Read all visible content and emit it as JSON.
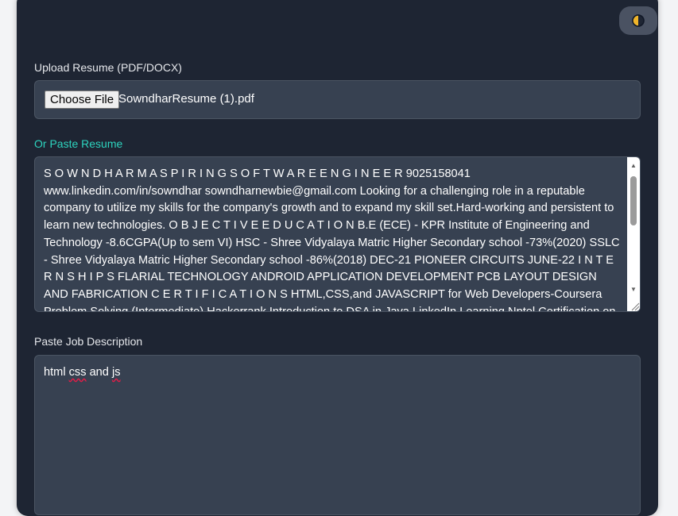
{
  "colors": {
    "page_bg": "#f3f4f6",
    "card_bg": "#1e2533",
    "field_bg": "#374151",
    "accent": "#2dd4bf",
    "toggle_icon": "#f0b52a"
  },
  "header": {
    "theme_toggle_icon": "half-circle-theme-icon"
  },
  "upload": {
    "label": "Upload Resume (PDF/DOCX)",
    "button_label": "Choose File",
    "file_name": "SowndharResume (1).pdf"
  },
  "resume": {
    "label": "Or Paste Resume",
    "text": "S O W N D H A R M A S P I R I N G S O F T W A R E E N G I N E E R 9025158041 www.linkedin.com/in/sowndhar  sowndharnewbie@gmail.com   Looking for a challenging role in a reputable company to utilize my skills for the company's growth and to expand my skill set.Hard-working and persistent to learn new technologies.  O B J E C T I V E  E D U C A T I O N  B.E (ECE) - KPR Institute of Engineering and Technology -8.6CGPA(Up to sem VI) HSC - Shree Vidyalaya Matric Higher Secondary school -73%(2020) SSLC - Shree Vidyalaya Matric Higher Secondary school -86%(2018)  DEC-21  PIONEER CIRCUITS  JUNE-22  I N T E R N S H I P S  FLARIAL TECHNOLOGY  ANDROID APPLICATION DEVELOPMENT  PCB LAYOUT DESIGN AND FABRICATION  C E R T I F I C A T I O N S  HTML,CSS,and JAVASCRIPT for Web Developers-Coursera Problem Solving (Intermediate)  Hackerrank Introduction to DSA in Java  LinkedIn Learning Nptel Certification on"
  },
  "job": {
    "label": "Paste Job Description",
    "text_prefix": "html ",
    "text_word1": "css",
    "text_middle": " and ",
    "text_word2": "js"
  }
}
